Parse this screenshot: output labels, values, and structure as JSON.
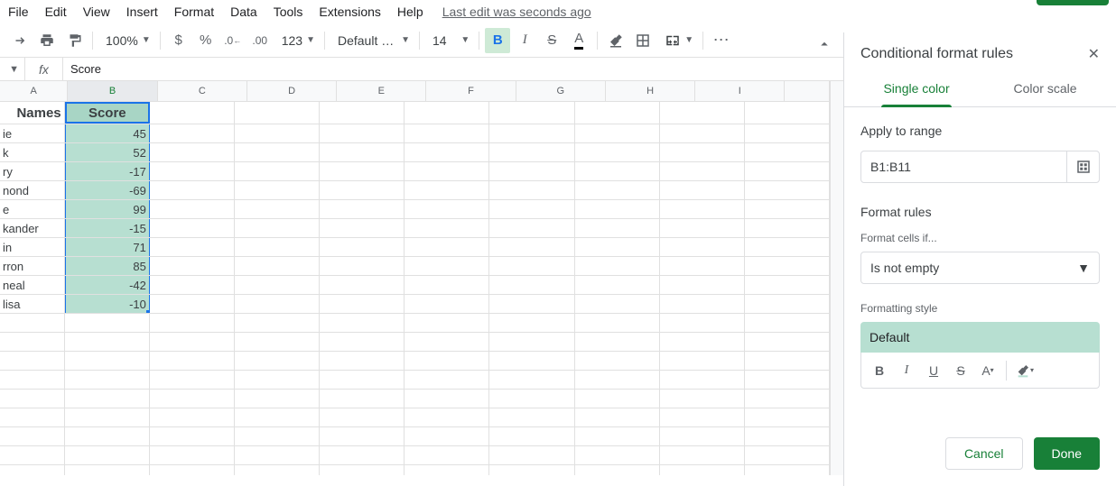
{
  "menus": [
    "File",
    "Edit",
    "View",
    "Insert",
    "Format",
    "Data",
    "Tools",
    "Extensions",
    "Help"
  ],
  "last_edit": "Last edit was seconds ago",
  "toolbar": {
    "zoom": "100%",
    "font": "Default (Ari...",
    "font_size": "14",
    "more_format": "123"
  },
  "formula_bar": {
    "fx": "fx",
    "value": "Score"
  },
  "columns": [
    "A",
    "B",
    "C",
    "D",
    "E",
    "F",
    "G",
    "H",
    "I",
    ""
  ],
  "header_row": {
    "a": "Names",
    "b": "Score"
  },
  "rows": [
    {
      "a": "ie",
      "b": "45"
    },
    {
      "a": "k",
      "b": "52"
    },
    {
      "a": "ry",
      "b": "-17"
    },
    {
      "a": "nond",
      "b": "-69"
    },
    {
      "a": "e",
      "b": "99"
    },
    {
      "a": "kander",
      "b": "-15"
    },
    {
      "a": "in",
      "b": "71"
    },
    {
      "a": "rron",
      "b": "85"
    },
    {
      "a": "neal",
      "b": "-42"
    },
    {
      "a": "lisa",
      "b": "-10"
    }
  ],
  "panel": {
    "title": "Conditional format rules",
    "tabs": {
      "single": "Single color",
      "scale": "Color scale"
    },
    "apply_label": "Apply to range",
    "range": "B1:B11",
    "rules_label": "Format rules",
    "cells_if_label": "Format cells if...",
    "condition": "Is not empty",
    "style_label": "Formatting style",
    "style_name": "Default",
    "cancel": "Cancel",
    "done": "Done"
  }
}
